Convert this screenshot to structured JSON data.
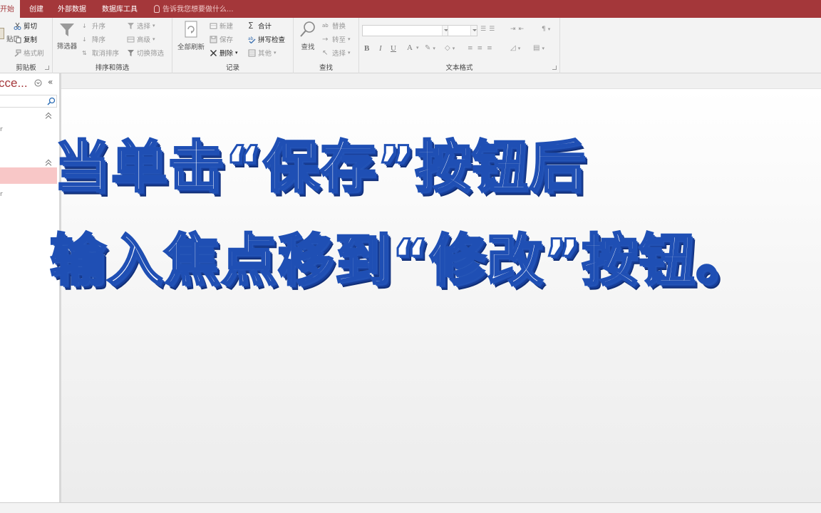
{
  "tabs": [
    "开始",
    "创建",
    "外部数据",
    "数据库工具"
  ],
  "tell_me": "告诉我您想要做什么...",
  "ribbon": {
    "clipboard": {
      "paste_fragment": "贴",
      "cut": "剪切",
      "copy": "复制",
      "format_painter": "格式刷",
      "label": "剪贴板"
    },
    "sort_filter": {
      "filter": "筛选器",
      "ascending": "升序",
      "descending": "降序",
      "remove_sort": "取消排序",
      "selection": "选择",
      "advanced": "高级",
      "toggle_filter": "切换筛选",
      "label": "排序和筛选"
    },
    "records": {
      "refresh_all": "全部刷新",
      "new": "新建",
      "save": "保存",
      "delete": "删除",
      "totals": "合计",
      "spelling": "拼写检查",
      "more": "其他",
      "label": "记录"
    },
    "find": {
      "find": "查找",
      "replace": "替换",
      "goto": "转至",
      "select": "选择",
      "label": "查找"
    },
    "text_format": {
      "label": "文本格式",
      "bold": "B",
      "italic": "I",
      "underline": "U",
      "font_color": "A"
    }
  },
  "nav": {
    "title": "cce..."
  },
  "caption": {
    "line1": "当单击“保存”按钮后",
    "line2": "输入焦点移到“修改”按钮。"
  },
  "colors": {
    "accent": "#a4373a",
    "caption_fill": "#ffffff",
    "caption_stroke": "#1f4fb4",
    "selected_row": "#f8c7c7"
  }
}
